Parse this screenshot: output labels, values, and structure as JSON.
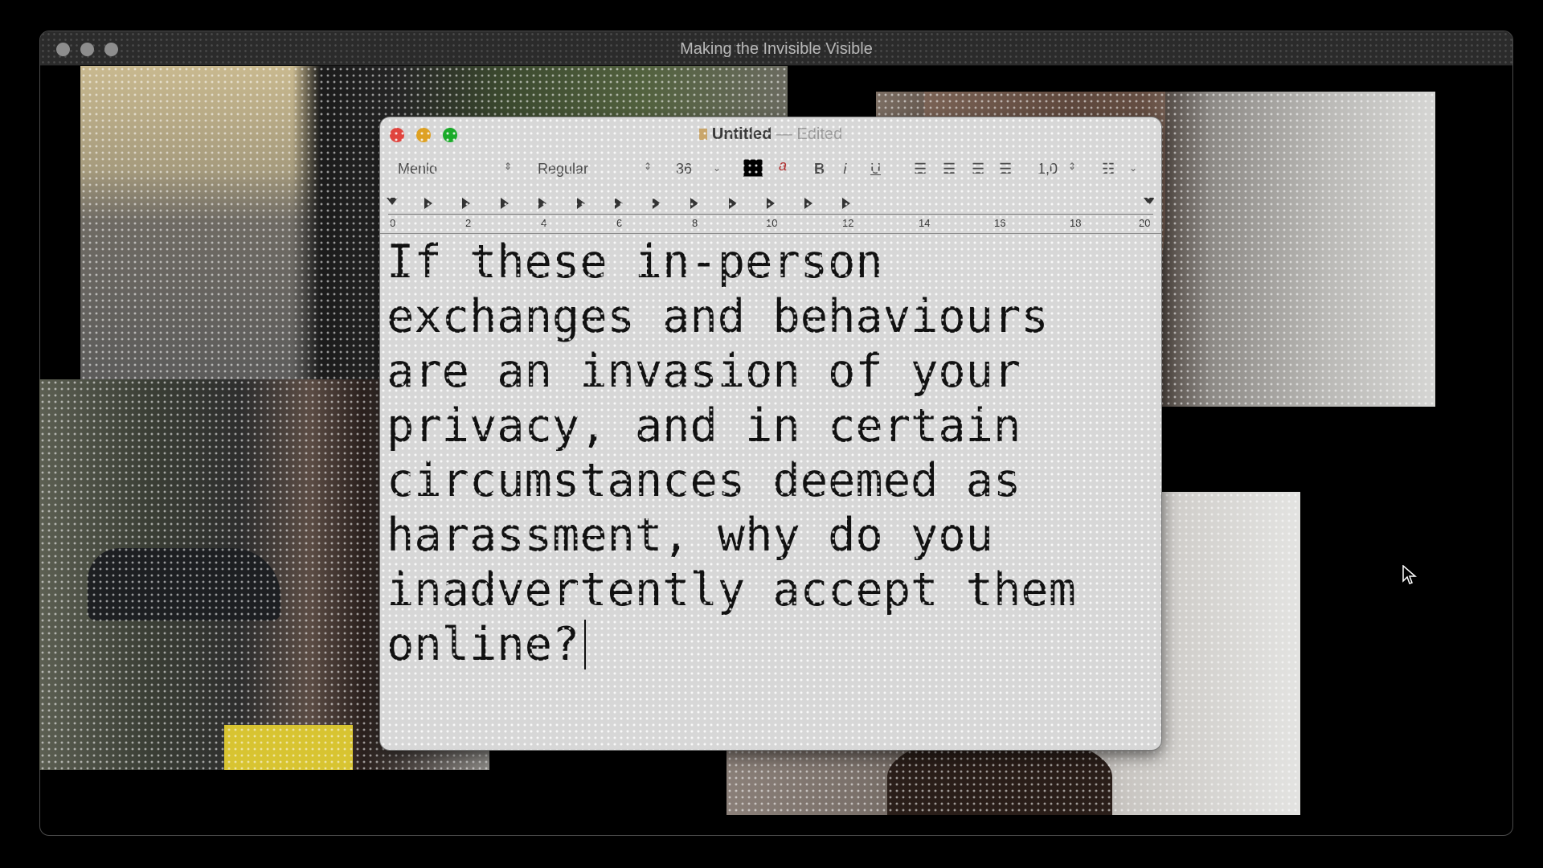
{
  "outer_window": {
    "title": "Making the Invisible Visible"
  },
  "textedit": {
    "title": "Untitled",
    "title_status": "— Edited",
    "toolbar": {
      "font_family": "Menlo",
      "font_style": "Regular",
      "font_size": "36",
      "bold_label": "B",
      "italic_label": "I",
      "underline_label": "U",
      "line_spacing": "1,0"
    },
    "ruler_ticks": [
      "0",
      "2",
      "4",
      "6",
      "8",
      "10",
      "12",
      "14",
      "16",
      "18",
      "20"
    ],
    "body_text": "If these in-person exchanges and behaviours are an invasion of your privacy, and in certain circumstances deemed as harassment, why do you inadvertently accept them online?"
  },
  "colors": {
    "close": "#e0443e",
    "minimize": "#dea123",
    "zoom": "#1aab29",
    "text_color_swatch": "#000000"
  }
}
